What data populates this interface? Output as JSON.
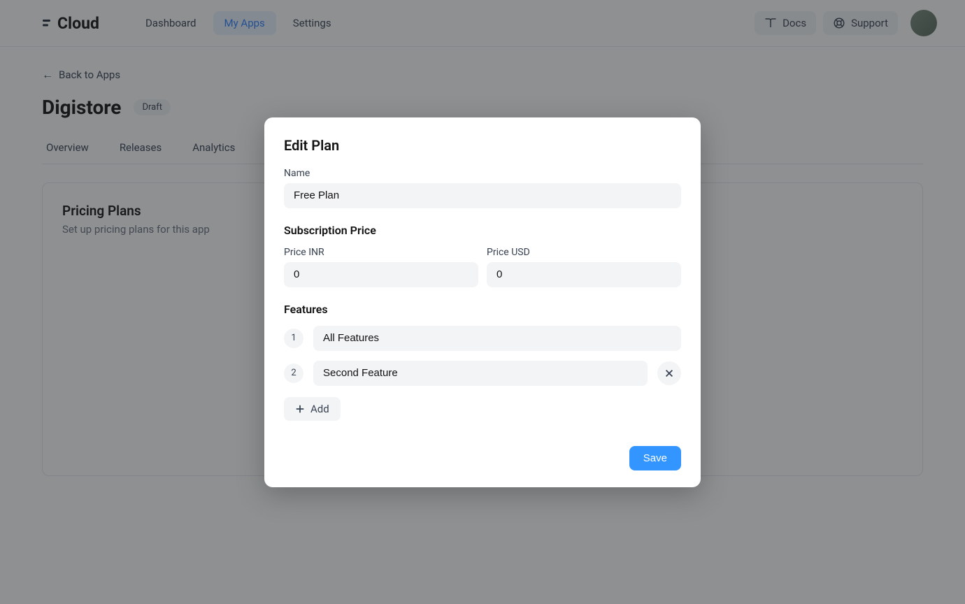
{
  "header": {
    "brand": "Cloud",
    "nav": {
      "dashboard": "Dashboard",
      "myapps": "My Apps",
      "settings": "Settings"
    },
    "docs": "Docs",
    "support": "Support"
  },
  "page": {
    "back": "Back to Apps",
    "app_name": "Digistore",
    "status": "Draft",
    "tabs": {
      "overview": "Overview",
      "releases": "Releases",
      "analytics": "Analytics"
    },
    "panel": {
      "title": "Pricing Plans",
      "subtitle": "Set up pricing plans for this app"
    }
  },
  "modal": {
    "title": "Edit Plan",
    "name_label": "Name",
    "name_value": "Free Plan",
    "subscription_title": "Subscription Price",
    "price_inr_label": "Price INR",
    "price_inr_value": "0",
    "price_usd_label": "Price USD",
    "price_usd_value": "0",
    "features_title": "Features",
    "features": [
      {
        "num": "1",
        "value": "All Features"
      },
      {
        "num": "2",
        "value": "Second Feature"
      }
    ],
    "add_label": "Add",
    "save_label": "Save"
  }
}
